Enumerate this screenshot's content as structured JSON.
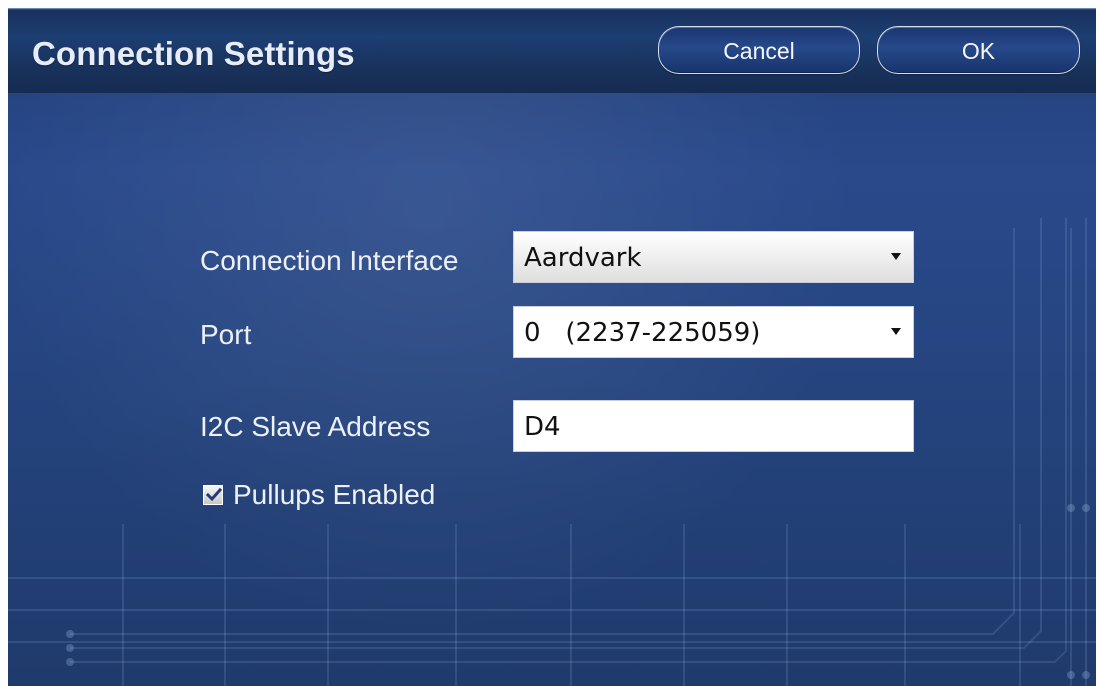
{
  "window": {
    "title": "Connection Settings"
  },
  "buttons": {
    "cancel": "Cancel",
    "ok": "OK"
  },
  "form": {
    "connection_interface": {
      "label": "Connection Interface",
      "value": "Aardvark"
    },
    "port": {
      "label": "Port",
      "value": "0   (2237-225059)"
    },
    "i2c_slave_address": {
      "label": "I2C Slave Address",
      "value": "D4"
    },
    "pullups_enabled": {
      "label": "Pullups Enabled",
      "checked": true
    }
  },
  "colors": {
    "background": "#25447f",
    "titlebar": "#1d3e72",
    "text": "#edf1f7",
    "button_border": "#f0f5ff"
  },
  "icons": {
    "dropdown": "chevron-down-icon",
    "checkbox": "checkmark-icon"
  }
}
